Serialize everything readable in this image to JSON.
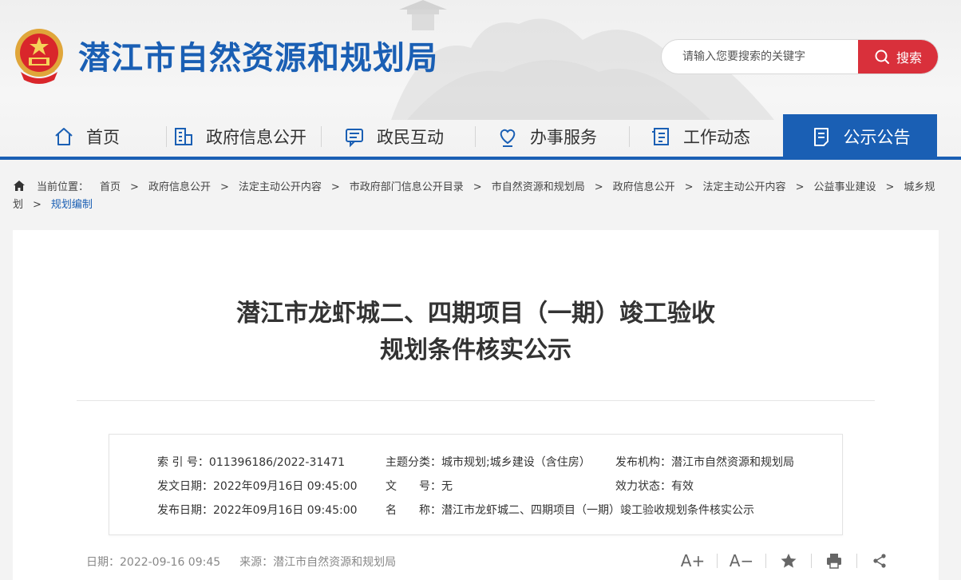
{
  "header": {
    "site_title": "潜江市自然资源和规划局",
    "search_placeholder": "请输入您要搜索的关键字",
    "search_button": "搜索"
  },
  "nav": {
    "items": [
      {
        "label": "首页",
        "icon": "home-icon"
      },
      {
        "label": "政府信息公开",
        "icon": "building-icon"
      },
      {
        "label": "政民互动",
        "icon": "chat-icon"
      },
      {
        "label": "办事服务",
        "icon": "heart-service-icon"
      },
      {
        "label": "工作动态",
        "icon": "document-list-icon"
      },
      {
        "label": "公示公告",
        "icon": "notice-icon",
        "active": true
      }
    ]
  },
  "breadcrumb": {
    "prefix": "当前位置：",
    "items": [
      "首页",
      "政府信息公开",
      "法定主动公开内容",
      "市政府部门信息公开目录",
      "市自然资源和规划局",
      "政府信息公开",
      "法定主动公开内容",
      "公益事业建设",
      "城乡规划"
    ],
    "current": "规划编制"
  },
  "article": {
    "title_line1": "潜江市龙虾城二、四期项目（一期）竣工验收",
    "title_line2": "规划条件核实公示",
    "meta": {
      "index_label": "索 引 号：",
      "index_value": "011396186/2022-31471",
      "topic_label": "主题分类：",
      "topic_value": "城市规划;城乡建设（含住房）",
      "publisher_label": "发布机构：",
      "publisher_value": "潜江市自然资源和规划局",
      "doc_date_label": "发文日期：",
      "doc_date_value": "2022年09月16日 09:45:00",
      "doc_no_label": "文　　号：",
      "doc_no_value": "无",
      "status_label": "效力状态：",
      "status_value": "有效",
      "pub_date_label": "发布日期：",
      "pub_date_value": "2022年09月16日 09:45:00",
      "name_label": "名　　称：",
      "name_value": "潜江市龙虾城二、四期项目（一期）竣工验收规划条件核实公示"
    },
    "date_text": "日期：2022-09-16 09:45",
    "source_text": "来源：潜江市自然资源和规划局",
    "tools": {
      "font_up": "A+",
      "font_down": "A−"
    }
  },
  "colors": {
    "brand_blue": "#1a5fb4",
    "search_red": "#d9303b"
  }
}
